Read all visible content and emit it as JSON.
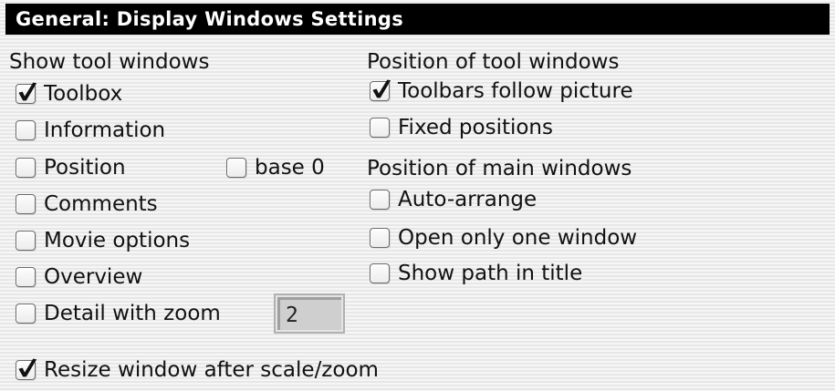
{
  "window": {
    "title": "General: Display Windows Settings"
  },
  "tool_windows": {
    "label": "Show tool windows",
    "items": [
      {
        "label": "Toolbox",
        "checked": true
      },
      {
        "label": "Information",
        "checked": false
      },
      {
        "label": "Position",
        "checked": false
      },
      {
        "label": "Comments",
        "checked": false
      },
      {
        "label": "Movie options",
        "checked": false
      },
      {
        "label": "Overview",
        "checked": false
      },
      {
        "label": "Detail with zoom",
        "checked": false
      }
    ],
    "base0": {
      "label": "base 0",
      "checked": false
    },
    "zoom_value": "2"
  },
  "tool_position": {
    "label": "Position of tool windows",
    "items": [
      {
        "label": "Toolbars follow picture",
        "checked": true
      },
      {
        "label": "Fixed positions",
        "checked": false
      }
    ]
  },
  "main_position": {
    "label": "Position of main windows",
    "items": [
      {
        "label": "Auto-arrange",
        "checked": false
      },
      {
        "label": "Open only one window",
        "checked": false
      },
      {
        "label": "Show path in title",
        "checked": false
      }
    ]
  },
  "resize": {
    "label": "Resize window after scale/zoom",
    "checked": true
  },
  "icons": {
    "checkmark": "checkmark-icon"
  },
  "colors": {
    "titlebar_bg": "#000000",
    "titlebar_text": "#ffffff",
    "checkbox_border": "#6a6a6a",
    "field_bg": "#cfcfcf"
  }
}
